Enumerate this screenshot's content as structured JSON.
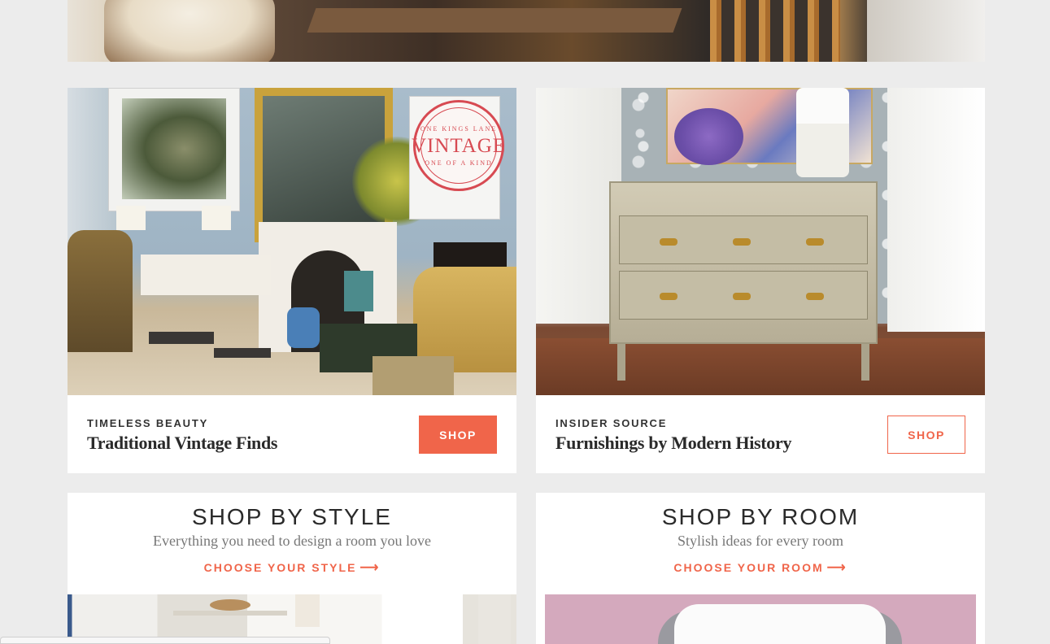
{
  "hero": {
    "image": "dining-room-photo"
  },
  "features": [
    {
      "eyebrow": "TIMELESS BEAUTY",
      "title": "Traditional Vintage Finds",
      "button": "SHOP",
      "button_style": "filled",
      "badge": {
        "top": "ONE KINGS LANE",
        "word": "VINTAGE",
        "bottom": "ONE OF A KIND"
      }
    },
    {
      "eyebrow": "INSIDER SOURCE",
      "title": "Furnishings by Modern History",
      "button": "SHOP",
      "button_style": "outline"
    }
  ],
  "shop_by": [
    {
      "heading": "SHOP BY STYLE",
      "sub": "Everything you need to design a room you love",
      "cta": "CHOOSE YOUR STYLE",
      "cta_icon": "arrow-right-icon"
    },
    {
      "heading": "SHOP BY ROOM",
      "sub": "Stylish ideas for every room",
      "cta": "CHOOSE YOUR ROOM",
      "cta_icon": "arrow-right-icon"
    }
  ],
  "colors": {
    "accent": "#f0654a",
    "badge": "#d74a52",
    "background": "#ececec"
  }
}
